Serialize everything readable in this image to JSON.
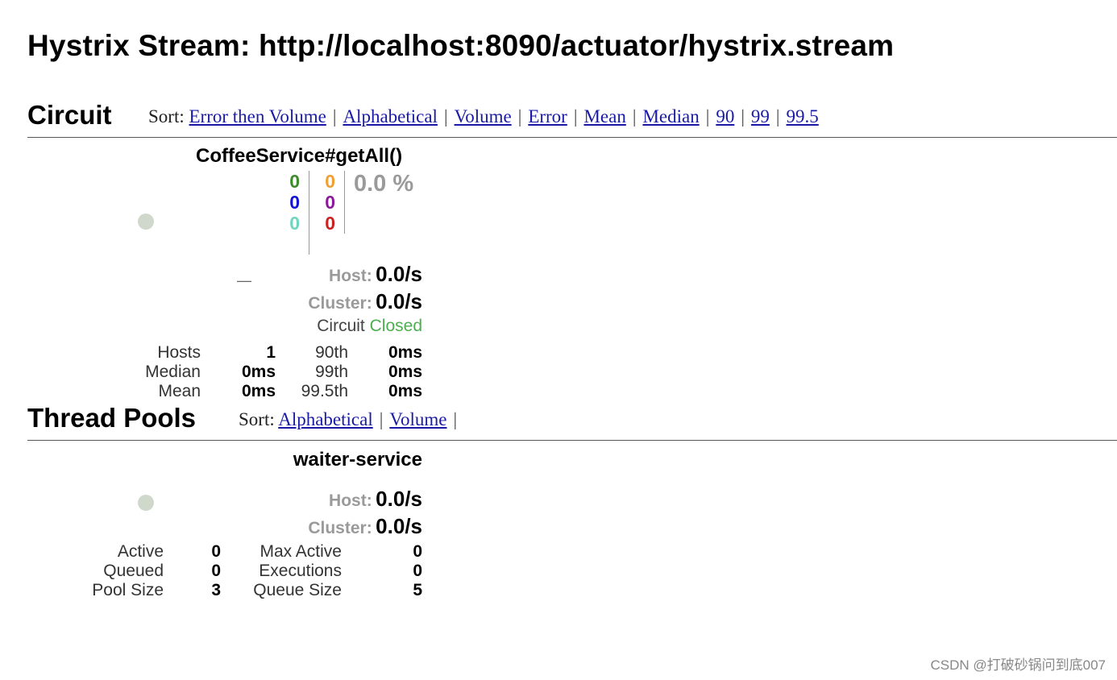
{
  "page": {
    "title": "Hystrix Stream: http://localhost:8090/actuator/hystrix.stream"
  },
  "circuit_section": {
    "title": "Circuit",
    "sort_label": "Sort:",
    "sort_options": [
      "Error then Volume",
      "Alphabetical",
      "Volume",
      "Error",
      "Mean",
      "Median",
      "90",
      "99",
      "99.5"
    ]
  },
  "circuit": {
    "name": "CoffeeService#getAll()",
    "counts_left": [
      "0",
      "0",
      "0"
    ],
    "counts_right": [
      "0",
      "0",
      "0"
    ],
    "error_percent": "0.0 %",
    "dash": "—",
    "host_label": "Host:",
    "host_rate": "0.0/s",
    "cluster_label": "Cluster:",
    "cluster_rate": "0.0/s",
    "circuit_label": "Circuit",
    "circuit_status": "Closed",
    "stats": [
      {
        "label": "Hosts",
        "value": "1",
        "plabel": "90th",
        "pvalue": "0ms"
      },
      {
        "label": "Median",
        "value": "0ms",
        "plabel": "99th",
        "pvalue": "0ms"
      },
      {
        "label": "Mean",
        "value": "0ms",
        "plabel": "99.5th",
        "pvalue": "0ms"
      }
    ]
  },
  "thread_section": {
    "title": "Thread Pools",
    "sort_label": "Sort:",
    "sort_options": [
      "Alphabetical",
      "Volume"
    ]
  },
  "thread_pool": {
    "name": "waiter-service",
    "host_label": "Host:",
    "host_rate": "0.0/s",
    "cluster_label": "Cluster:",
    "cluster_rate": "0.0/s",
    "stats": [
      {
        "label": "Active",
        "value": "0",
        "label2": "Max Active",
        "value2": "0"
      },
      {
        "label": "Queued",
        "value": "0",
        "label2": "Executions",
        "value2": "0"
      },
      {
        "label": "Pool Size",
        "value": "3",
        "label2": "Queue Size",
        "value2": "5"
      }
    ]
  },
  "colors": {
    "success": "#3c8c2c",
    "short_circuited": "#1414d4",
    "bad_request": "#6fd6c0",
    "timeout": "#f0a030",
    "rejected": "#8a1a9a",
    "failure": "#cc2222",
    "closed": "#4caf50",
    "health_dot": "#d0d8cc"
  },
  "watermark": "CSDN @打破砂锅问到底007"
}
